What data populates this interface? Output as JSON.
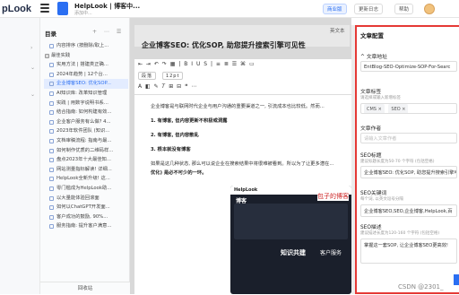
{
  "topbar": {
    "brand": "pLook",
    "doc_title": "HelpLook | 博客中...",
    "doc_sub": "添加中...",
    "buttons": {
      "business": "商业版",
      "update": "更新日志",
      "help": "帮助"
    }
  },
  "directory": {
    "header": "目录",
    "tools": "+ ⋯ ☰",
    "items": [
      {
        "label": "内容排序 (按删除/取上...",
        "type": "doc"
      },
      {
        "label": "最佳实践",
        "type": "folder"
      },
      {
        "label": "实用方法 | 搭建类正确...",
        "type": "doc"
      },
      {
        "label": "2024年趋势 | 12个台...",
        "type": "doc"
      },
      {
        "label": "企业博客SEO: 优化SOP...",
        "type": "doc",
        "active": true
      },
      {
        "label": "AI知识库: 改革知识管理",
        "type": "doc"
      },
      {
        "label": "实践 | 用数字说明书系...",
        "type": "doc"
      },
      {
        "label": "结合指南: 如何构建有效...",
        "type": "doc"
      },
      {
        "label": "企业客户服务有么做? 4...",
        "type": "doc"
      },
      {
        "label": "2023年软件团队 (知识...",
        "type": "doc"
      },
      {
        "label": "文档审稿流程: 指南与最...",
        "type": "doc"
      },
      {
        "label": "如何制作优质的二维码样...",
        "type": "doc"
      },
      {
        "label": "盘点2023年十大最佳知...",
        "type": "doc"
      },
      {
        "label": "网站测量指标解读! 详细...",
        "type": "doc"
      },
      {
        "label": "HelpLook全新升级! 这...",
        "type": "doc"
      },
      {
        "label": "零门槛成为HelpLook助...",
        "type": "doc"
      },
      {
        "label": "以大量能体验回滚面",
        "type": "doc"
      },
      {
        "label": "如何以ChatGPT开发面...",
        "type": "doc"
      },
      {
        "label": "客户成功的鼓励, 90%...",
        "type": "doc"
      },
      {
        "label": "服务指南: 提升客户满意...",
        "type": "doc"
      }
    ],
    "recycle": "回收站"
  },
  "editor": {
    "title": "企业博客SEO: 优化SOP, 助您提升搜索引擎可见性",
    "eng_button": "英文本",
    "toolbar_row1": "⇤ ⇥ ↶ ↷ ▦  |  B I U S  |  ≡ ≣ ☰ ⌘ ▭",
    "format_select": "段落",
    "size_select": "12pt",
    "toolbar_row3": "A ◧ ✎ 𝑇 ⊞ ⊟ ❝ ⋯",
    "paragraphs": [
      {
        "text": "企业博客是与联网时代企业与用户沟通的重要渠道之一, 引流成本也比较低。然而...",
        "bold": false
      },
      {
        "text": "1. 有博客, 但内容更新不积极或洞露",
        "bold": true
      },
      {
        "text": "2. 有博客, 但内容散乱",
        "bold": true
      },
      {
        "text": "3. 根本就没有博客",
        "bold": true
      },
      {
        "text": "如果是这几种状态, 那么可以说企业在搜索结果中将很难被看到。所以为了让更多潜在...",
        "bold": false
      },
      {
        "text": "优化) 是必不可少的一环。",
        "bold": true
      }
    ],
    "embedded": {
      "brand": "HelpLook",
      "header": "博客",
      "label_a": "知识共建",
      "label_b": "客户服务"
    },
    "handwriting": "包子的博客"
  },
  "config": {
    "title": "文章配置",
    "url_label": "^ 文章地址",
    "url_value": "EntBlog-SEO-Optimize-SOP-For-Searc",
    "tags_label": "文章标签",
    "tags_hint": "请选择或输入新增标签",
    "tags": [
      "CMS ×",
      "SEO ×"
    ],
    "author_label": "文章作者",
    "author_placeholder": "请输入文章作者",
    "seo_title_label": "SEO标题",
    "seo_title_hint": "建议标题长度为50-70 个字符 (包括空格)",
    "seo_title_value": "企业博客SEO: 优化SOP, 助您提升搜索引擎可见...",
    "seo_kw_label": "SEO关键词",
    "seo_kw_hint": "每个词, 以英文逗号分隔",
    "seo_kw_value": "企业博客SEO,SEO,企业博客,HelpLook,百",
    "seo_desc_label": "SEO描述",
    "seo_desc_hint": "建议描述长度为120-160 个字符 (包括空格)",
    "seo_desc_value": "掌握这一套SOP, 让企业博客SEO更高效!"
  },
  "watermark": "CSDN @2301_"
}
